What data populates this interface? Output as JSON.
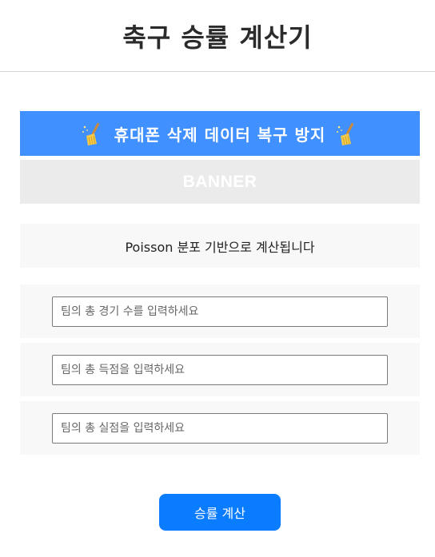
{
  "page": {
    "title": "축구 승률 계산기"
  },
  "promo_banner": {
    "text": "휴대폰 삭제 데이터 복구 방지",
    "left_icon": "broom-icon",
    "right_icon": "broom-icon",
    "background_color": "#4090ff"
  },
  "ad_banner": {
    "label": "BANNER"
  },
  "info": {
    "text": "Poisson 분포 기반으로 계산됩니다"
  },
  "form": {
    "games_placeholder": "팀의 총 경기 수를 입력하세요",
    "goals_for_placeholder": "팀의 총 득점을 입력하세요",
    "goals_against_placeholder": "팀의 총 실점을 입력하세요"
  },
  "actions": {
    "calculate_label": "승률 계산",
    "button_color": "#0a7cff"
  }
}
